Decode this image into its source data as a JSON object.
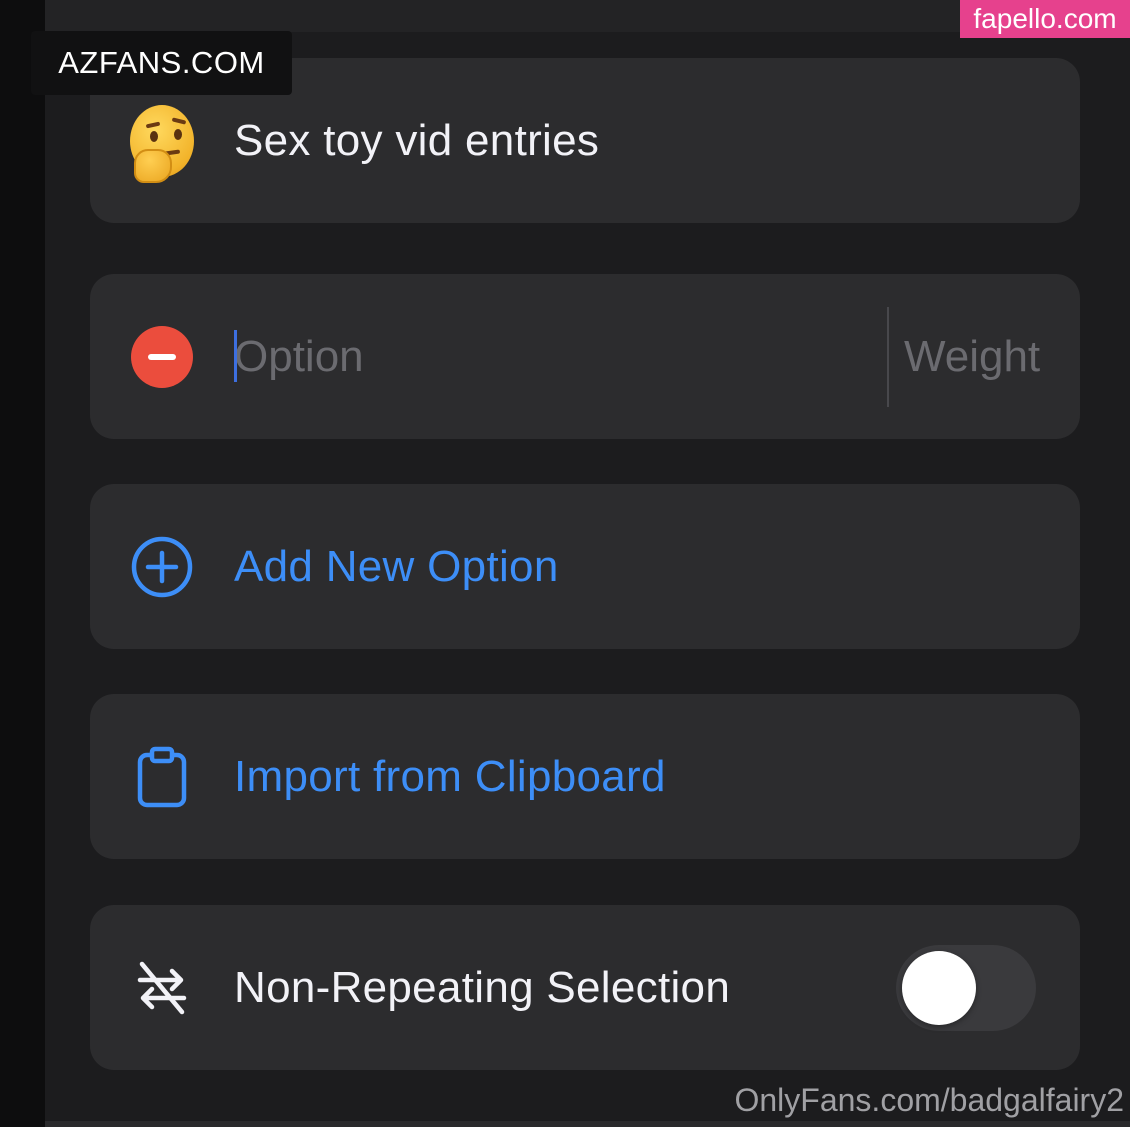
{
  "title_card": {
    "emoji": "thinking-face",
    "title": "Sex toy vid entries"
  },
  "option_row": {
    "option_placeholder": "Option",
    "weight_placeholder": "Weight"
  },
  "actions": {
    "add_new_option": "Add New Option",
    "import_from_clipboard": "Import from Clipboard"
  },
  "non_repeating": {
    "label": "Non-Repeating Selection",
    "enabled": false
  },
  "overlays": {
    "azfans": "AZFANS.COM",
    "fapello": "fapello.com",
    "onlyfans": "OnlyFans.com/badgalfairy2"
  },
  "colors": {
    "background": "#1c1c1e",
    "card": "#2c2c2e",
    "accent_blue": "#3d8ef7",
    "delete_red": "#eb4d3d",
    "fapello_pink": "#e6418d"
  }
}
